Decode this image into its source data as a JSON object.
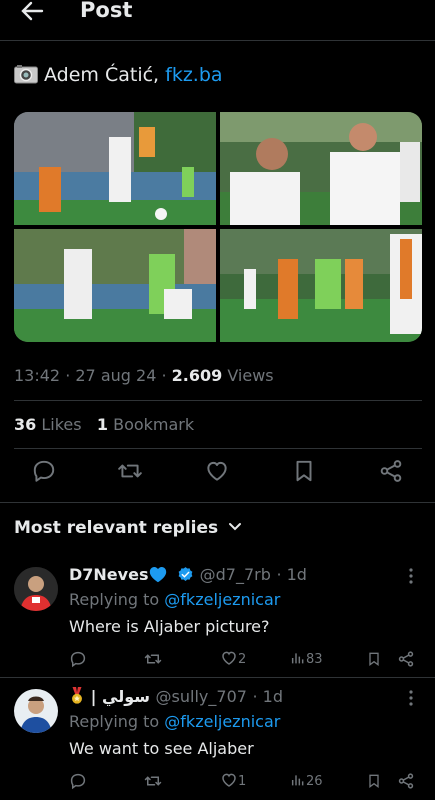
{
  "header": {
    "title": "Post"
  },
  "post": {
    "author_text": "Adem Ćatić, ",
    "link_text": "fkz.ba",
    "time": "13:42",
    "dot1": " · ",
    "date": "27 aug 24",
    "dot2": " · ",
    "views_count": "2.609",
    "views_label": " Views",
    "likes_count": "36",
    "likes_label": " Likes",
    "bookmarks_count": "1",
    "bookmarks_label": " Bookmark"
  },
  "replies_header": {
    "label": "Most relevant replies"
  },
  "replies": [
    {
      "name": "D7Neves",
      "handle": "@d7_7rb",
      "time": "· 1d",
      "replying_prefix": "Replying to ",
      "replying_to": "@fkzeljeznicar",
      "text": "Where is Aljaber picture?",
      "likes": "2",
      "views": "83"
    },
    {
      "name": "| سولي",
      "handle": "@sully_707",
      "time": "· 1d",
      "replying_prefix": "Replying to ",
      "replying_to": "@fkzeljeznicar",
      "text": "We want to see Aljaber",
      "likes": "1",
      "views": "26"
    }
  ],
  "colors": {
    "accent": "#1d9bf0",
    "muted": "#71767b",
    "verified": "#1d9bf0",
    "heart_emoji": "#1d9bf0"
  },
  "icons": [
    "back-arrow-icon",
    "camera-icon",
    "reply-icon",
    "retweet-icon",
    "like-icon",
    "bookmark-icon",
    "share-icon",
    "chevron-down-icon",
    "more-icon",
    "verified-icon",
    "medal-icon",
    "analytics-icon"
  ]
}
